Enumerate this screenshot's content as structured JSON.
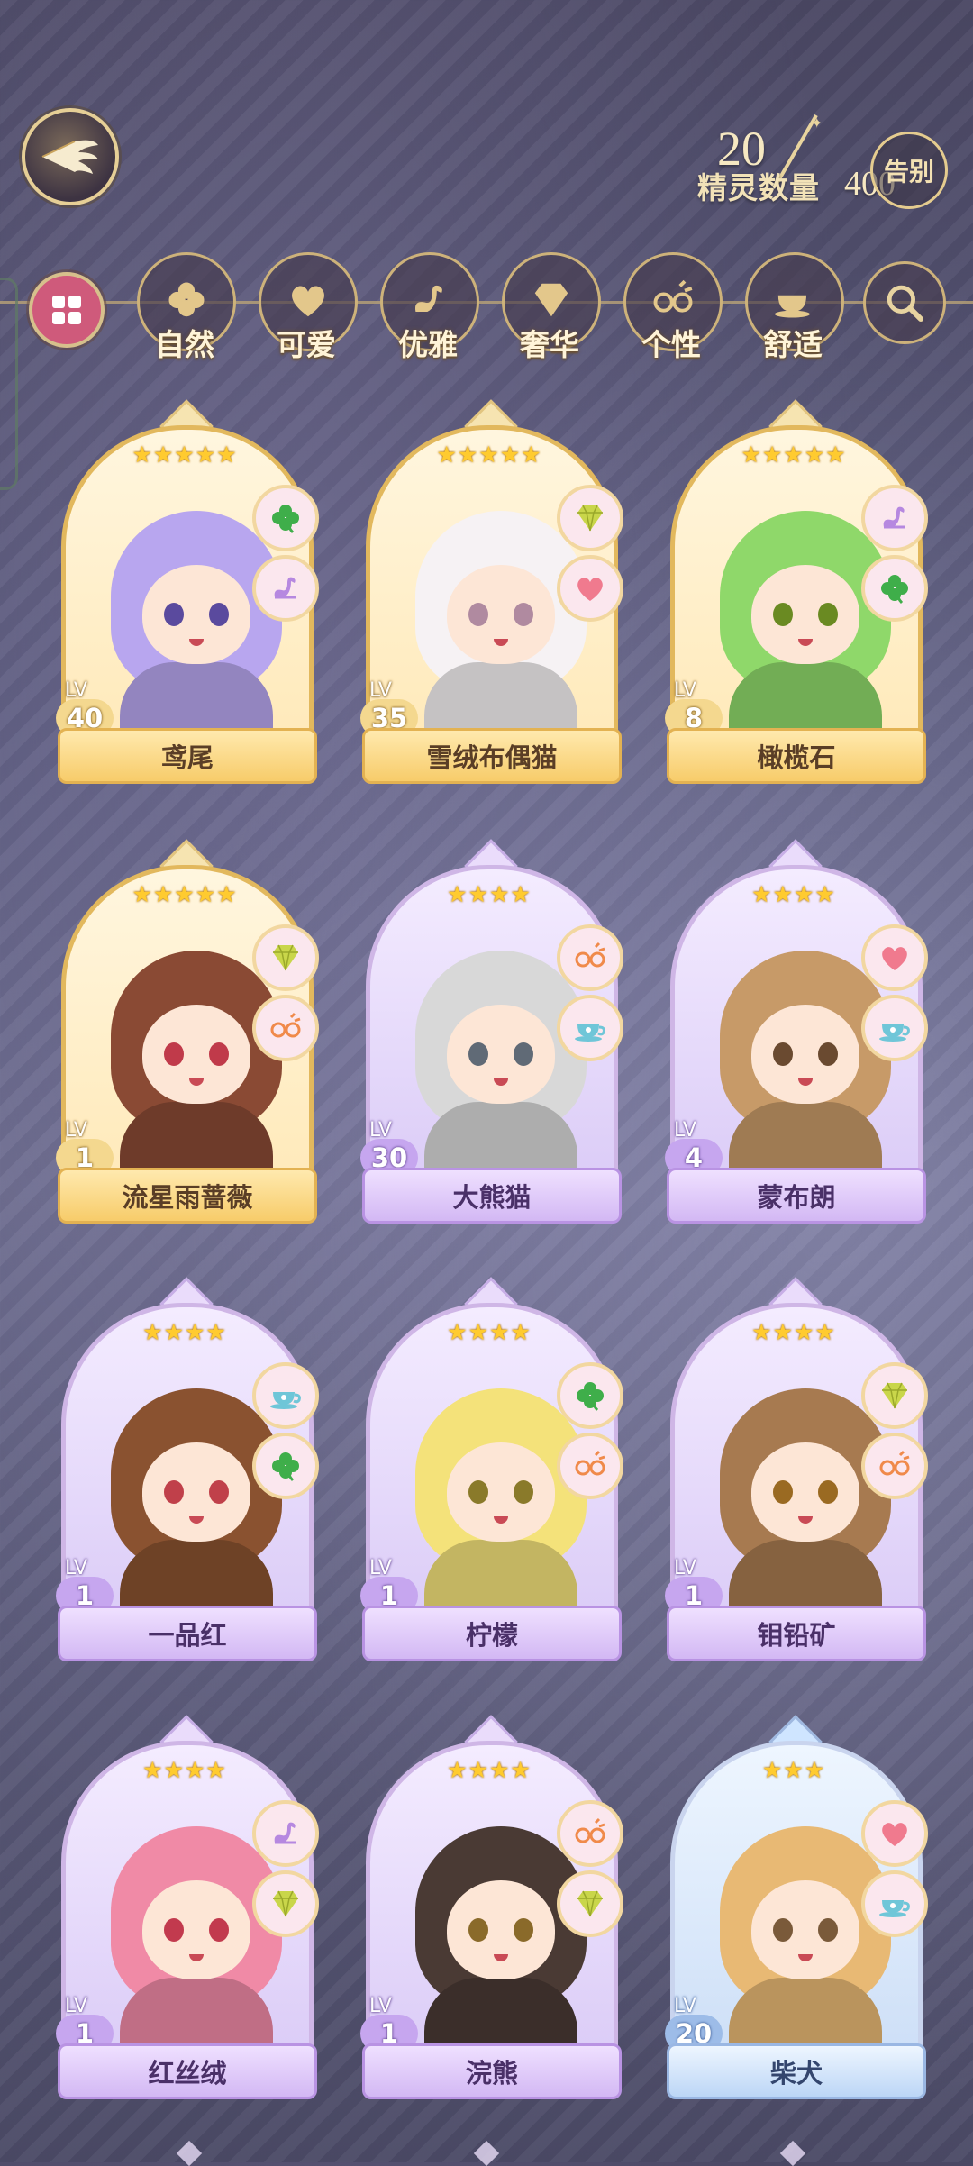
{
  "header": {
    "count_label": "精灵数量",
    "count_current": "20",
    "count_max": "400",
    "farewell_label": "告别"
  },
  "filters": [
    {
      "label": "自然",
      "icon": "clover-icon"
    },
    {
      "label": "可爱",
      "icon": "heart-icon"
    },
    {
      "label": "优雅",
      "icon": "swan-icon"
    },
    {
      "label": "奢华",
      "icon": "diamond-icon"
    },
    {
      "label": "个性",
      "icon": "glasses-icon"
    },
    {
      "label": "舒适",
      "icon": "teacup-icon"
    }
  ],
  "cards": [
    {
      "name": "鸢尾",
      "lv": "40",
      "stars": "★★★★★",
      "rarity": "gold",
      "badges": [
        "clover-icon",
        "swan-icon"
      ],
      "hair": "#b8a6ef",
      "eye": "#5a4a9e"
    },
    {
      "name": "雪绒布偶猫",
      "lv": "35",
      "stars": "★★★★★",
      "rarity": "gold",
      "badges": [
        "diamond-icon",
        "heart-icon"
      ],
      "hair": "#f6f2f4",
      "eye": "#b08aa0"
    },
    {
      "name": "橄榄石",
      "lv": "8",
      "stars": "★★★★★",
      "rarity": "gold",
      "badges": [
        "swan-icon",
        "clover-icon"
      ],
      "hair": "#8fd86a",
      "eye": "#6a8a22"
    },
    {
      "name": "流星雨蔷薇",
      "lv": "1",
      "stars": "★★★★★",
      "rarity": "gold",
      "badges": [
        "diamond-icon",
        "glasses-icon"
      ],
      "hair": "#8a4a34",
      "eye": "#c03a4a"
    },
    {
      "name": "大熊猫",
      "lv": "30",
      "stars": "★★★★",
      "rarity": "purple",
      "badges": [
        "glasses-icon",
        "teacup-icon"
      ],
      "hair": "#d8d8d8",
      "eye": "#606a76"
    },
    {
      "name": "蒙布朗",
      "lv": "4",
      "stars": "★★★★",
      "rarity": "purple",
      "badges": [
        "heart-icon",
        "teacup-icon"
      ],
      "hair": "#c79a68",
      "eye": "#6a4a30"
    },
    {
      "name": "一品红",
      "lv": "1",
      "stars": "★★★★",
      "rarity": "purple",
      "badges": [
        "teacup-icon",
        "clover-icon"
      ],
      "hair": "#8a5230",
      "eye": "#c0404a"
    },
    {
      "name": "柠檬",
      "lv": "1",
      "stars": "★★★★",
      "rarity": "purple",
      "badges": [
        "clover-icon",
        "glasses-icon"
      ],
      "hair": "#f4e27a",
      "eye": "#8a7a2a"
    },
    {
      "name": "钼铅矿",
      "lv": "1",
      "stars": "★★★★",
      "rarity": "purple",
      "badges": [
        "diamond-icon",
        "glasses-icon"
      ],
      "hair": "#a77a50",
      "eye": "#9a6a22"
    },
    {
      "name": "红丝绒",
      "lv": "1",
      "stars": "★★★★",
      "rarity": "purple",
      "badges": [
        "swan-icon",
        "diamond-icon"
      ],
      "hair": "#f08aa6",
      "eye": "#c23a4e"
    },
    {
      "name": "浣熊",
      "lv": "1",
      "stars": "★★★★",
      "rarity": "purple",
      "badges": [
        "glasses-icon",
        "diamond-icon"
      ],
      "hair": "#4a3a34",
      "eye": "#8a6a2a"
    },
    {
      "name": "柴犬",
      "lv": "20",
      "stars": "★★★",
      "rarity": "blue",
      "badges": [
        "heart-icon",
        "teacup-icon"
      ],
      "hair": "#e8b974",
      "eye": "#7a5a3a"
    }
  ],
  "colors": {
    "gold": "#e2b85d",
    "purple": "#b993e3",
    "blue": "#9ab7e3",
    "badge_pink": "#fbe7ee"
  }
}
